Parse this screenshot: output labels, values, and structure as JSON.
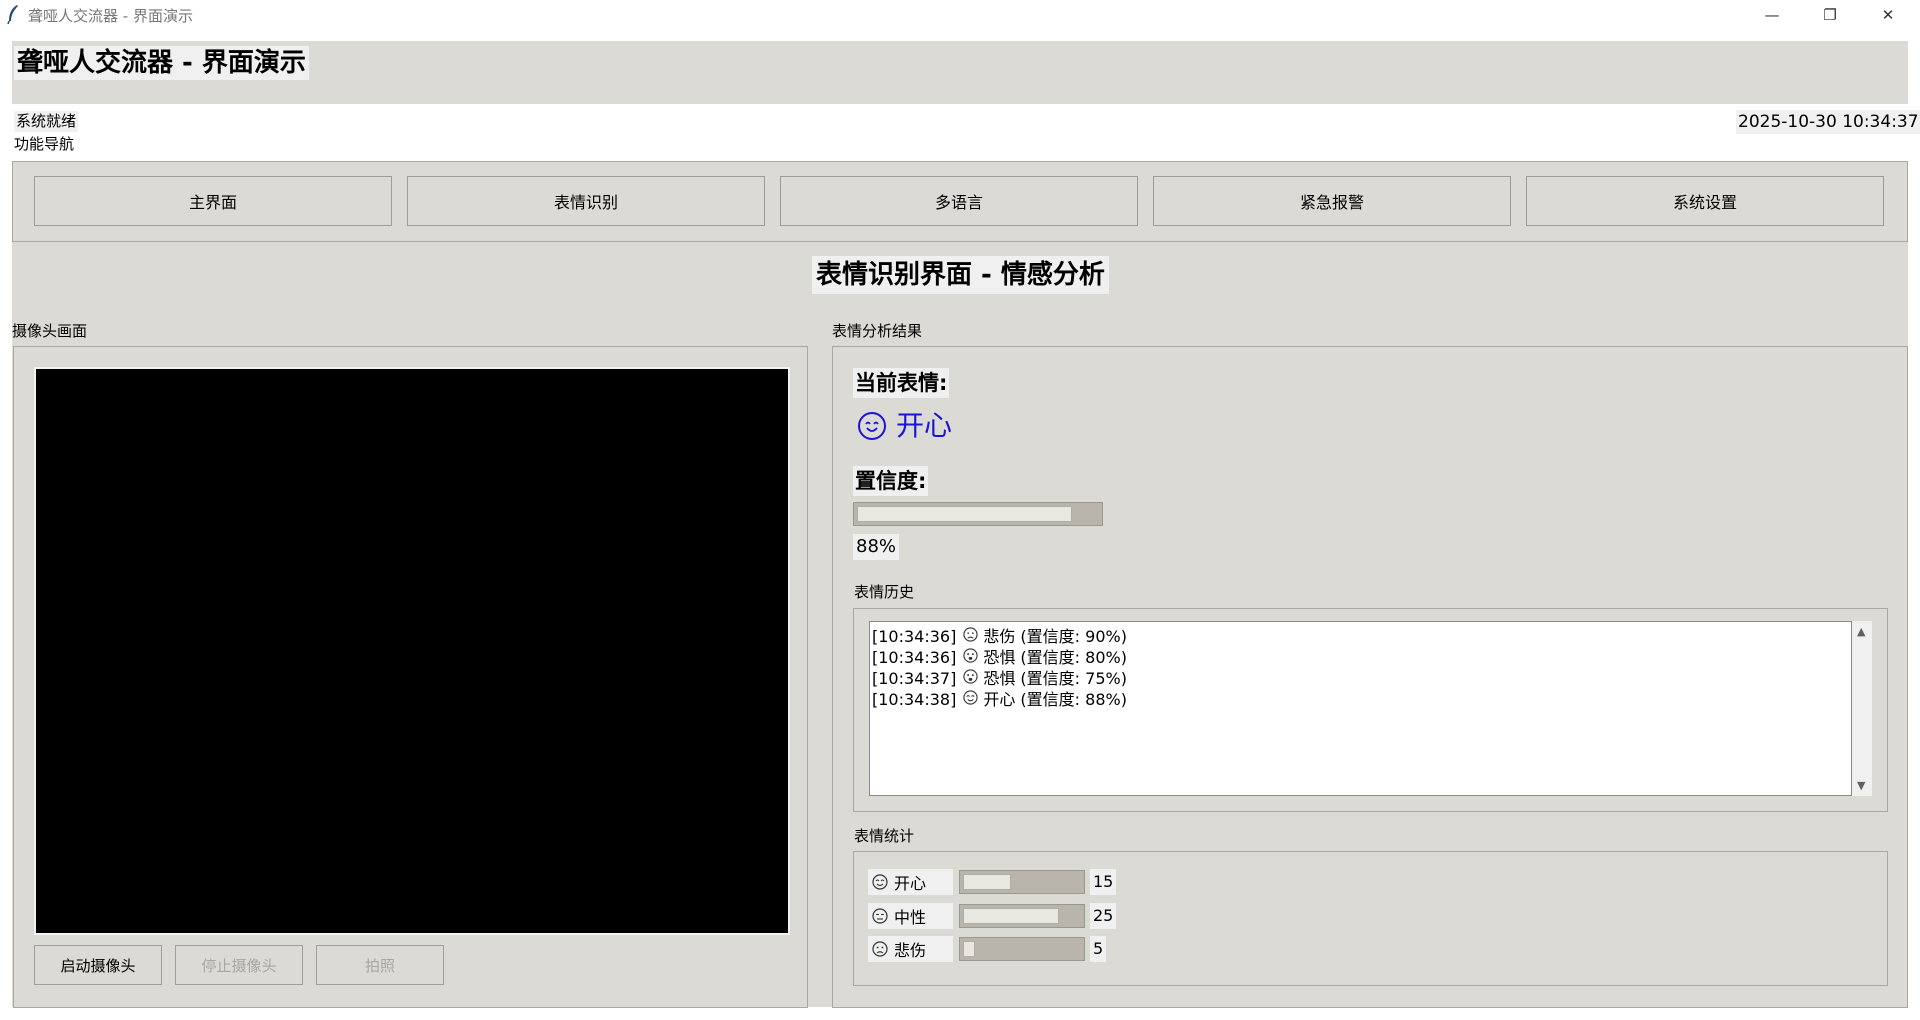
{
  "window": {
    "title": "聋哑人交流器 - 界面演示",
    "controls": {
      "minimize": "—",
      "restore": "❐",
      "close": "✕"
    }
  },
  "header": {
    "title": "聋哑人交流器 - 界面演示",
    "status": "系统就绪",
    "datetime": "2025-10-30 10:34:37"
  },
  "nav": {
    "caption": "功能导航",
    "buttons": [
      "主界面",
      "表情识别",
      "多语言",
      "紧急报警",
      "系统设置"
    ]
  },
  "screen_title": "表情识别界面 - 情感分析",
  "camera": {
    "caption": "摄像头画面",
    "buttons": {
      "start": "启动摄像头",
      "stop": "停止摄像头",
      "photo": "拍照"
    }
  },
  "result": {
    "caption": "表情分析结果",
    "current_label": "当前表情:",
    "current_emotion": "开心",
    "current_icon": "happy-face-icon",
    "confidence_label": "置信度:",
    "confidence_value": "88%",
    "confidence_fraction": 0.88
  },
  "history": {
    "caption": "表情历史",
    "entries": [
      {
        "time": "[10:34:36]",
        "icon": "sad-face-icon",
        "text": "悲伤 (置信度: 90%)"
      },
      {
        "time": "[10:34:36]",
        "icon": "fear-face-icon",
        "text": "恐惧 (置信度: 80%)"
      },
      {
        "time": "[10:34:37]",
        "icon": "fear-face-icon",
        "text": "恐惧 (置信度: 75%)"
      },
      {
        "time": "[10:34:38]",
        "icon": "happy-face-icon",
        "text": "开心 (置信度: 88%)"
      }
    ]
  },
  "stats": {
    "caption": "表情统计",
    "items": [
      {
        "label": "开心",
        "icon": "happy-face-icon",
        "count": "15",
        "fraction": 0.4
      },
      {
        "label": "中性",
        "icon": "neutral-face-icon",
        "count": "25",
        "fraction": 0.8
      },
      {
        "label": "悲伤",
        "icon": "sad-face-icon",
        "count": "5",
        "fraction": 0.1
      }
    ]
  },
  "colors": {
    "surface": "#dcdad5",
    "emotion_text": "#1a14d6"
  }
}
